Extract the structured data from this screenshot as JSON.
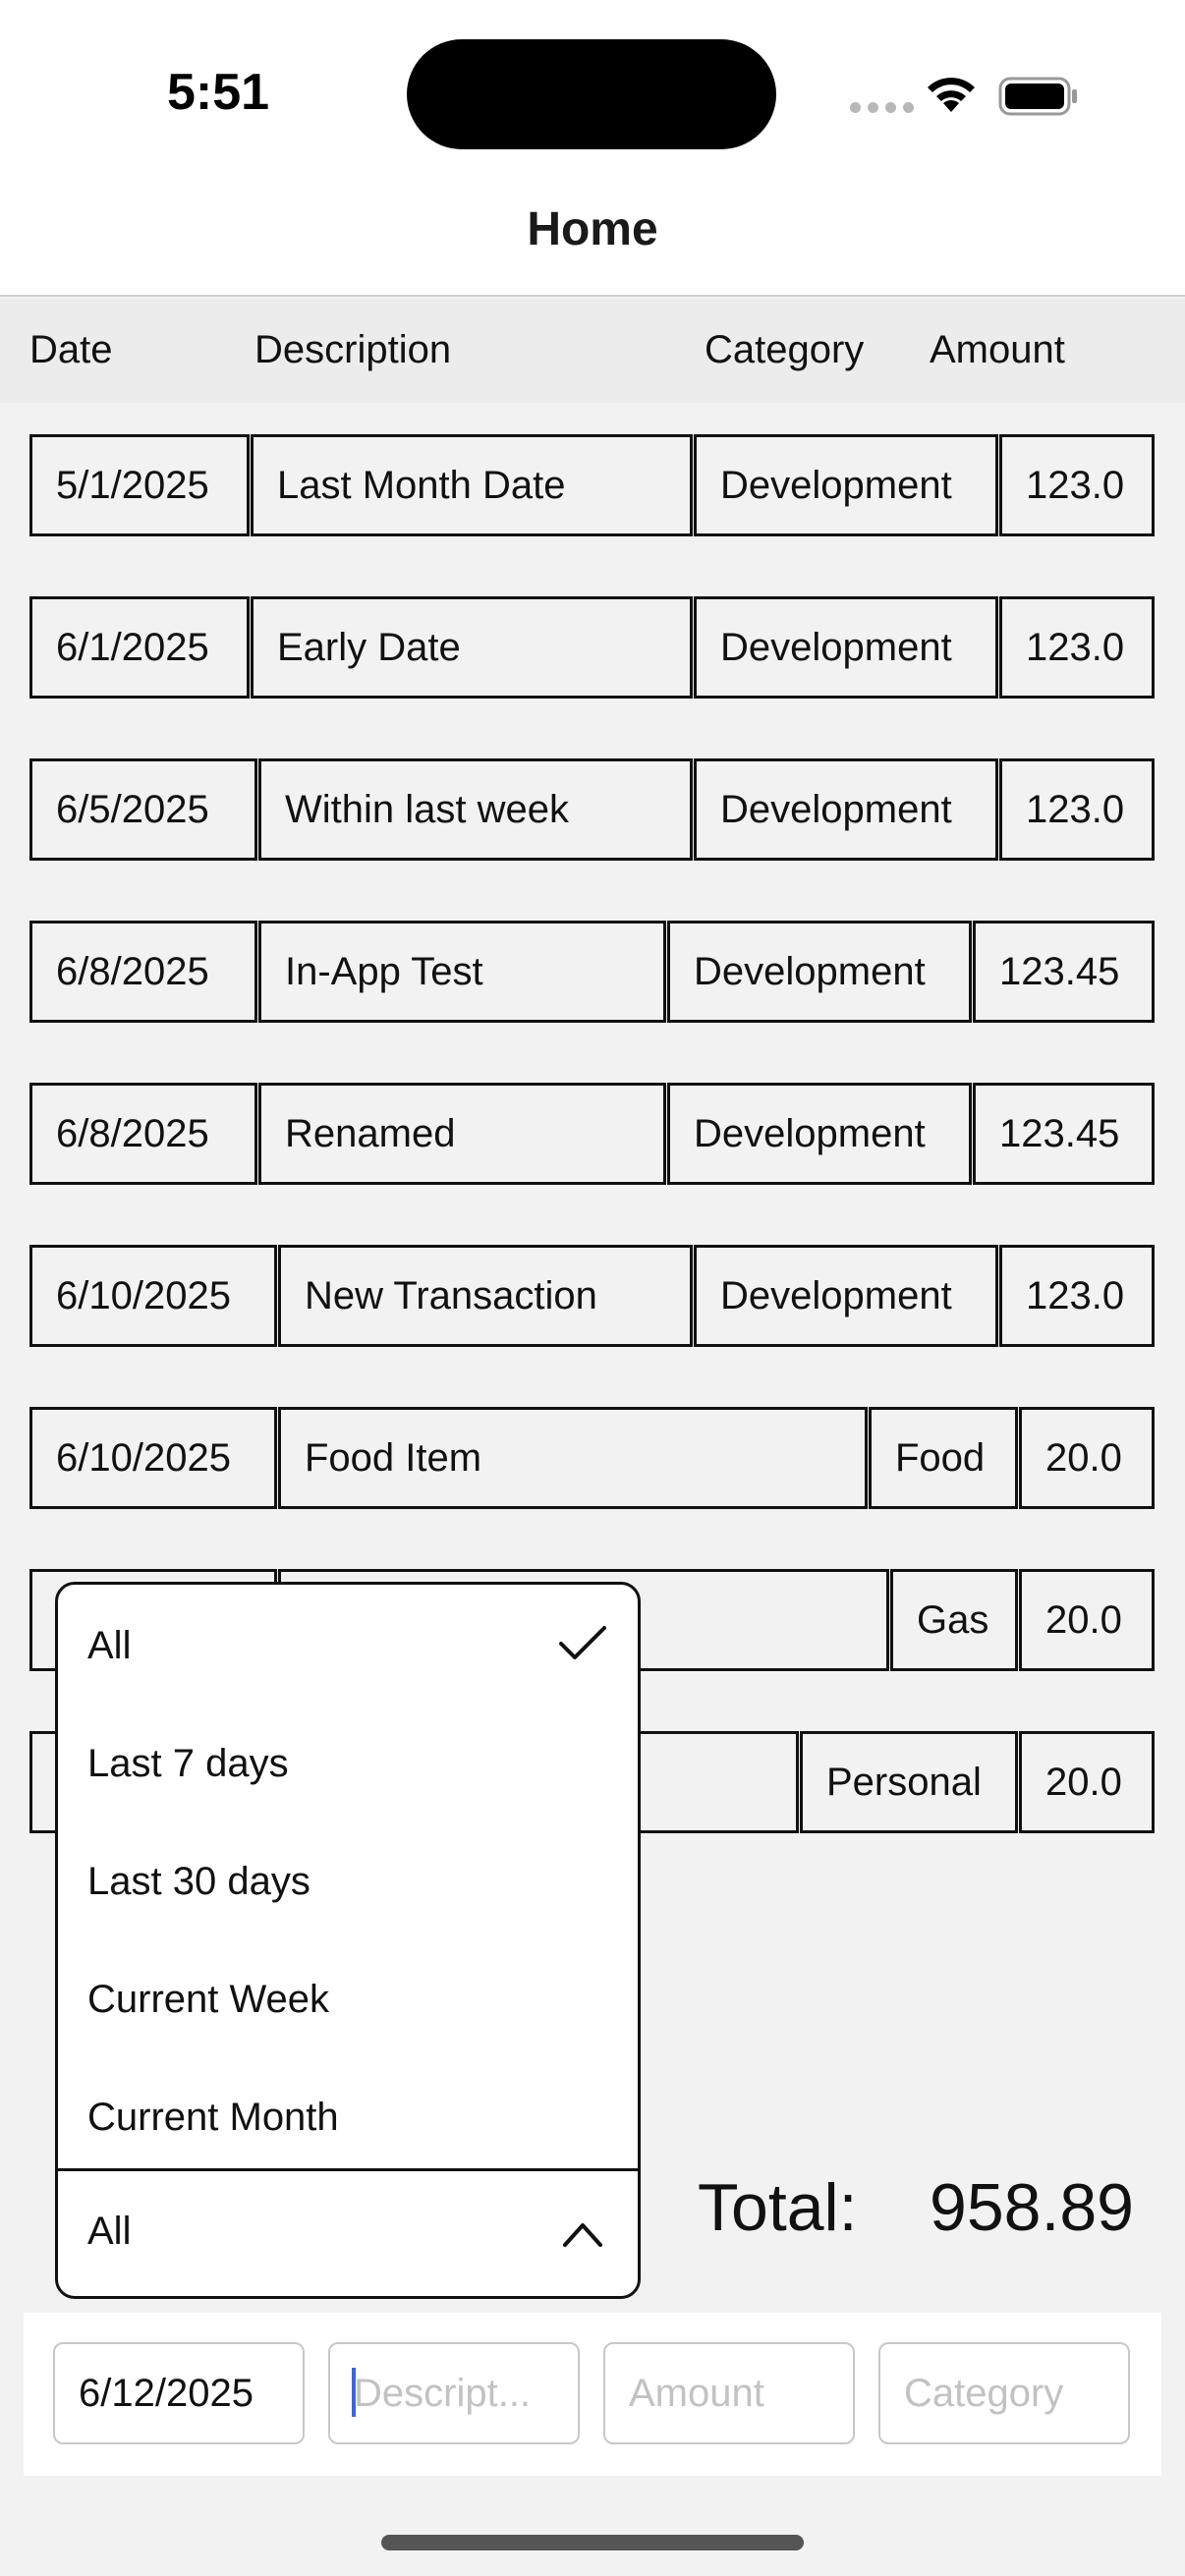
{
  "status_bar": {
    "time": "5:51"
  },
  "nav": {
    "title": "Home"
  },
  "table": {
    "headers": {
      "date": "Date",
      "description": "Description",
      "category": "Category",
      "amount": "Amount"
    },
    "rows": [
      {
        "date": "5/1/2025",
        "description": "Last Month Date",
        "category": "Development",
        "amount": "123.0"
      },
      {
        "date": "6/1/2025",
        "description": "Early Date",
        "category": "Development",
        "amount": "123.0"
      },
      {
        "date": "6/5/2025",
        "description": "Within last week",
        "category": "Development",
        "amount": "123.0"
      },
      {
        "date": "6/8/2025",
        "description": "In-App Test",
        "category": "Development",
        "amount": "123.45"
      },
      {
        "date": "6/8/2025",
        "description": "Renamed",
        "category": "Development",
        "amount": "123.45"
      },
      {
        "date": "6/10/2025",
        "description": "New Transaction",
        "category": "Development",
        "amount": "123.0"
      },
      {
        "date": "6/10/2025",
        "description": "Food Item",
        "category": "Food",
        "amount": "20.0"
      },
      {
        "date": "",
        "description": "",
        "category": "Gas",
        "amount": "20.0"
      },
      {
        "date": "",
        "description": "",
        "category": "Personal",
        "amount": "20.0"
      }
    ]
  },
  "filter_dropdown": {
    "options": [
      "All",
      "Last 7 days",
      "Last 30 days",
      "Current Week",
      "Current Month"
    ],
    "selected": "All"
  },
  "summary": {
    "total_label": "Total:",
    "total_value": "958.89"
  },
  "new_entry": {
    "date_value": "6/12/2025",
    "description_placeholder": "Descript...",
    "amount_placeholder": "Amount",
    "category_placeholder": "Category"
  }
}
